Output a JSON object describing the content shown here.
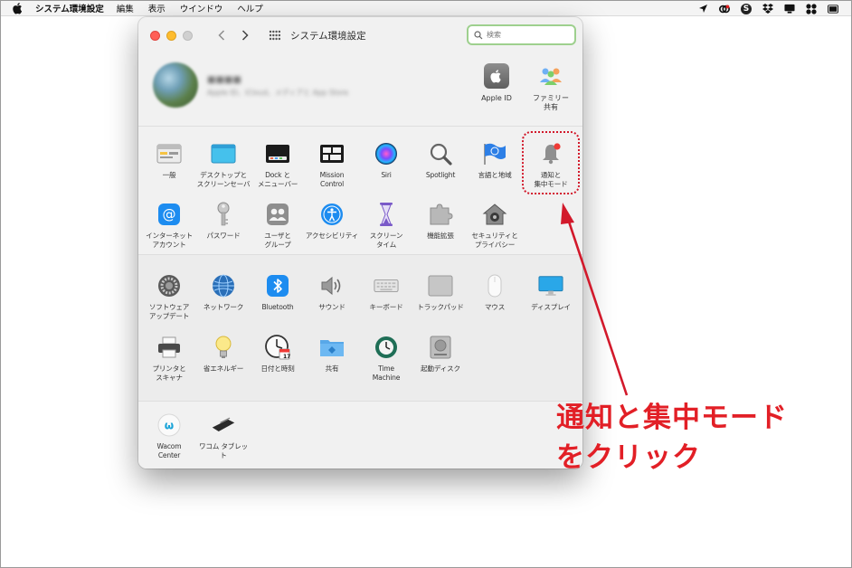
{
  "menubar": {
    "app_name": "システム環境設定",
    "items": [
      "編集",
      "表示",
      "ウインドウ",
      "ヘルプ"
    ],
    "status_icons": [
      "location-arrow-icon",
      "creative-cloud-icon",
      "skype-icon",
      "dropbox-icon",
      "display-icon",
      "bluetooth-cluster-icon",
      "battery-icon"
    ]
  },
  "window": {
    "title": "システム環境設定",
    "search_placeholder": "検索"
  },
  "profile": {
    "name": "■■■■",
    "subtitle": "Apple ID、iCloud、メディアと App Store",
    "apple_id_label": "Apple ID",
    "family_label": "ファミリー\n共有"
  },
  "section_a": {
    "row1": [
      {
        "label": "一般",
        "icon": "general-icon"
      },
      {
        "label": "デスクトップと\nスクリーンセーバ",
        "icon": "desktop-icon"
      },
      {
        "label": "Dock と\nメニューバー",
        "icon": "dock-icon"
      },
      {
        "label": "Mission\nControl",
        "icon": "mission-control-icon"
      },
      {
        "label": "Siri",
        "icon": "siri-icon"
      },
      {
        "label": "Spotlight",
        "icon": "spotlight-icon"
      },
      {
        "label": "言語と地域",
        "icon": "language-flag-icon"
      },
      {
        "label": "通知と\n集中モード",
        "icon": "notification-bell-icon"
      }
    ],
    "row2": [
      {
        "label": "インターネット\nアカウント",
        "icon": "internet-accounts-icon"
      },
      {
        "label": "パスワード",
        "icon": "key-icon"
      },
      {
        "label": "ユーザと\nグループ",
        "icon": "users-icon"
      },
      {
        "label": "アクセシビリティ",
        "icon": "accessibility-icon"
      },
      {
        "label": "スクリーン\nタイム",
        "icon": "hourglass-icon"
      },
      {
        "label": "機能拡張",
        "icon": "puzzle-icon"
      },
      {
        "label": "セキュリティと\nプライバシー",
        "icon": "security-house-icon"
      }
    ]
  },
  "section_b": {
    "row1": [
      {
        "label": "ソフトウェア\nアップデート",
        "icon": "gear-update-icon"
      },
      {
        "label": "ネットワーク",
        "icon": "network-globe-icon"
      },
      {
        "label": "Bluetooth",
        "icon": "bluetooth-icon"
      },
      {
        "label": "サウンド",
        "icon": "speaker-icon"
      },
      {
        "label": "キーボード",
        "icon": "keyboard-icon"
      },
      {
        "label": "トラックパッド",
        "icon": "trackpad-icon"
      },
      {
        "label": "マウス",
        "icon": "mouse-icon"
      },
      {
        "label": "ディスプレイ",
        "icon": "display-icon"
      }
    ],
    "row2": [
      {
        "label": "プリンタと\nスキャナ",
        "icon": "printer-icon"
      },
      {
        "label": "省エネルギー",
        "icon": "lightbulb-icon"
      },
      {
        "label": "日付と時刻",
        "icon": "clock-calendar-icon"
      },
      {
        "label": "共有",
        "icon": "sharing-folder-icon"
      },
      {
        "label": "Time\nMachine",
        "icon": "time-machine-icon"
      },
      {
        "label": "起動ディスク",
        "icon": "disk-icon"
      }
    ],
    "calendar_day": "17"
  },
  "section_c": {
    "items": [
      {
        "label": "Wacom\nCenter",
        "icon": "wacom-icon"
      },
      {
        "label": "ワコム タブレット",
        "icon": "tablet-icon"
      }
    ]
  },
  "callout": {
    "line1": "通知と集中モード",
    "line2": "をクリック"
  },
  "colors": {
    "annotation_red": "#e21f26",
    "search_focus": "#9ed08e",
    "accent_blue": "#1d8cf0"
  }
}
